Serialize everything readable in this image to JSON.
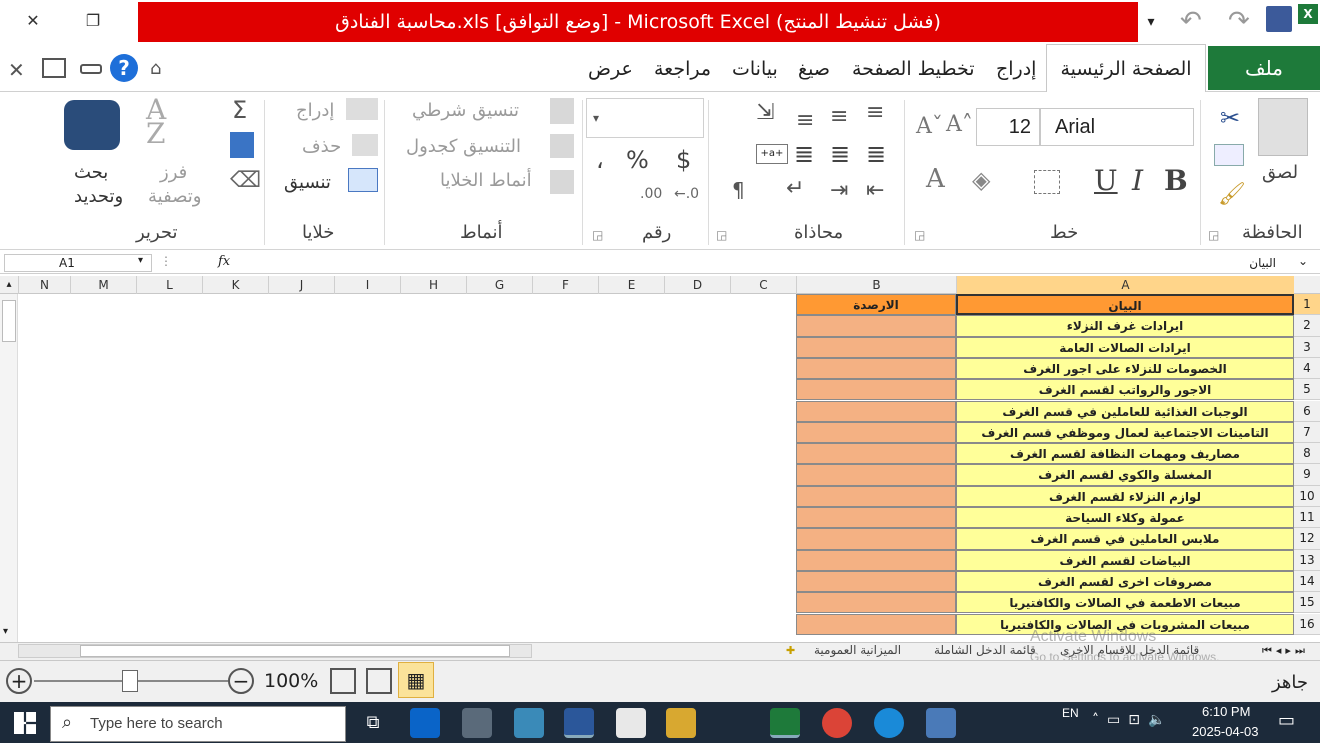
{
  "title": "محاسبة الفنادق.xls  [وضع التوافق] - Microsoft Excel (فشل تنشيط المنتج)",
  "tabs": {
    "file": "ملف",
    "home": "الصفحة الرئيسية",
    "insert": "إدراج",
    "page_layout": "تخطيط الصفحة",
    "formulas": "صيغ",
    "data": "بيانات",
    "review": "مراجعة",
    "view": "عرض"
  },
  "ribbon": {
    "clipboard": {
      "label": "الحافظة",
      "paste": "لصق"
    },
    "font": {
      "label": "خط",
      "name": "Arial",
      "size": "12",
      "bold": "B",
      "italic": "I",
      "underline": "U"
    },
    "alignment": {
      "label": "محاذاة"
    },
    "number": {
      "label": "رقم",
      "currency": "$",
      "percent": "%",
      "comma": "،"
    },
    "styles": {
      "label": "أنماط",
      "conditional": "تنسيق شرطي",
      "table": "التنسيق كجدول",
      "cell_styles": "أنماط الخلايا"
    },
    "cells": {
      "label": "خلايا",
      "insert": "إدراج",
      "delete": "حذف",
      "format": "تنسيق"
    },
    "editing": {
      "label": "تحرير",
      "sort": "فرز\nوتصفية",
      "sort_line1": "فرز",
      "sort_line2": "وتصفية",
      "find_line1": "بحث",
      "find_line2": "وتحديد",
      "sigma": "Σ"
    }
  },
  "formula_bar": {
    "name_box": "A1",
    "fx": "fx",
    "content": "البيان"
  },
  "columns": [
    "A",
    "B",
    "C",
    "D",
    "E",
    "F",
    "G",
    "H",
    "I",
    "J",
    "K",
    "L",
    "M",
    "N"
  ],
  "rows": [
    {
      "num": "1",
      "a": "البيان",
      "b": "الارصدة"
    },
    {
      "num": "2",
      "a": "ايرادات غرف النزلاء",
      "b": ""
    },
    {
      "num": "3",
      "a": "ايرادات الصالات العامة",
      "b": ""
    },
    {
      "num": "4",
      "a": "الخصومات للنزلاء على اجور الغرف",
      "b": ""
    },
    {
      "num": "5",
      "a": "الاجور والرواتب لقسم الغرف",
      "b": ""
    },
    {
      "num": "6",
      "a": "الوجبات الغذائية للعاملين في قسم الغرف",
      "b": ""
    },
    {
      "num": "7",
      "a": "التامينات الاجتماعية لعمال وموظفي قسم الغرف",
      "b": ""
    },
    {
      "num": "8",
      "a": "مصاريف ومهمات النظافة لقسم الغرف",
      "b": ""
    },
    {
      "num": "9",
      "a": "المغسلة والكوي لقسم الغرف",
      "b": ""
    },
    {
      "num": "10",
      "a": "لوازم النزلاء لقسم الغرف",
      "b": ""
    },
    {
      "num": "11",
      "a": "عمولة وكلاء السياحة",
      "b": ""
    },
    {
      "num": "12",
      "a": "ملابس العاملين في قسم الغرف",
      "b": ""
    },
    {
      "num": "13",
      "a": "البياضات لقسم الغرف",
      "b": ""
    },
    {
      "num": "14",
      "a": "مصروفات اخرى لقسم الغرف",
      "b": ""
    },
    {
      "num": "15",
      "a": "مبيعات الاطعمة في الصالات والكافتيريا",
      "b": ""
    },
    {
      "num": "16",
      "a": "مبيعات المشروبات في الصالات والكافتيريا",
      "b": ""
    }
  ],
  "sheet_tabs": [
    "قائمة الدخل للاقسام الاخرى",
    "قائمة الدخل الشاملة",
    "الميزانية العمومية"
  ],
  "status": {
    "ready": "جاهز",
    "zoom": "100%"
  },
  "watermark": {
    "line1": "Activate Windows",
    "line2": "Go to Settings to activate Windows."
  },
  "taskbar": {
    "search_placeholder": "Type here to search",
    "lang": "EN",
    "time": "6:10 PM",
    "date": "2025-04-03"
  },
  "colors": {
    "title_red": "#e00000",
    "file_green": "#1e7a3a",
    "cell_yellow": "#ffff99",
    "cell_orange": "#f4b183",
    "header_orange": "#ff9933"
  }
}
